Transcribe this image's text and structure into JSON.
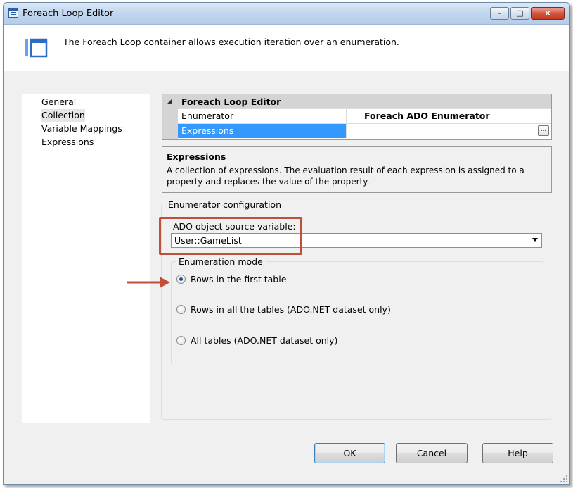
{
  "window": {
    "title": "Foreach Loop Editor",
    "controls": {
      "minimize": "–",
      "maximize": "□",
      "close": "✕"
    }
  },
  "header": {
    "description": "The Foreach Loop container allows execution iteration over an enumeration."
  },
  "nav": {
    "items": [
      {
        "label": "General",
        "selected": false
      },
      {
        "label": "Collection",
        "selected": true
      },
      {
        "label": "Variable Mappings",
        "selected": false
      },
      {
        "label": "Expressions",
        "selected": false
      }
    ]
  },
  "property_grid": {
    "category": "Foreach Loop Editor",
    "collapse_glyph": "◢",
    "rows": [
      {
        "name": "Enumerator",
        "value": "Foreach ADO Enumerator"
      },
      {
        "name": "Expressions",
        "value": "",
        "button": "..."
      }
    ]
  },
  "description_panel": {
    "title": "Expressions",
    "text": "A collection of expressions. The evaluation result of each expression is assigned to a property and replaces the value of the property."
  },
  "enumerator_config": {
    "group_label": "Enumerator configuration",
    "source_label": "ADO object source variable:",
    "source_value": "User::GameList",
    "mode_label": "Enumeration mode",
    "modes": [
      {
        "label": "Rows in the first table",
        "checked": true
      },
      {
        "label": "Rows in all the tables (ADO.NET dataset only)",
        "checked": false
      },
      {
        "label": "All tables (ADO.NET dataset only)",
        "checked": false
      }
    ]
  },
  "buttons": {
    "ok": "OK",
    "cancel": "Cancel",
    "help": "Help"
  },
  "colors": {
    "accent_selection": "#3399ff",
    "annotation": "#c0503a"
  }
}
